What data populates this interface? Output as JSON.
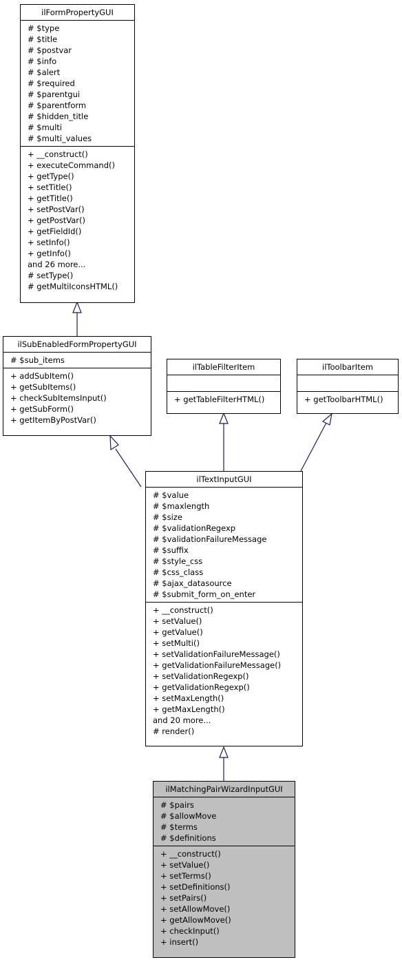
{
  "classes": {
    "form_property": {
      "name": "ilFormPropertyGUI",
      "attributes": [
        "# $type",
        "# $title",
        "# $postvar",
        "# $info",
        "# $alert",
        "# $required",
        "# $parentgui",
        "# $parentform",
        "# $hidden_title",
        "# $multi",
        "# $multi_values"
      ],
      "methods": [
        "+ __construct()",
        "+ executeCommand()",
        "+ getType()",
        "+ setTitle()",
        "+ getTitle()",
        "+ setPostVar()",
        "+ getPostVar()",
        "+ getFieldId()",
        "+ setInfo()",
        "+ getInfo()",
        "and 26 more...",
        "# setType()",
        "# getMultiIconsHTML()"
      ]
    },
    "sub_enabled": {
      "name": "ilSubEnabledFormPropertyGUI",
      "attributes": [
        "# $sub_items"
      ],
      "methods": [
        "+ addSubItem()",
        "+ getSubItems()",
        "+ checkSubItemsInput()",
        "+ getSubForm()",
        "+ getItemByPostVar()"
      ]
    },
    "table_filter": {
      "name": "ilTableFilterItem",
      "attributes": [],
      "methods": [
        "+ getTableFilterHTML()"
      ]
    },
    "toolbar_item": {
      "name": "ilToolbarItem",
      "attributes": [],
      "methods": [
        "+ getToolbarHTML()"
      ]
    },
    "text_input": {
      "name": "ilTextInputGUI",
      "attributes": [
        "# $value",
        "# $maxlength",
        "# $size",
        "# $validationRegexp",
        "# $validationFailureMessage",
        "# $suffix",
        "# $style_css",
        "# $css_class",
        "# $ajax_datasource",
        "# $submit_form_on_enter"
      ],
      "methods": [
        "+ __construct()",
        "+ setValue()",
        "+ getValue()",
        "+ setMulti()",
        "+ setValidationFailureMessage()",
        "+ getValidationFailureMessage()",
        "+ setValidationRegexp()",
        "+ getValidationRegexp()",
        "+ setMaxLength()",
        "+ getMaxLength()",
        "and 20 more...",
        "# render()"
      ]
    },
    "matching_pair": {
      "name": "ilMatchingPairWizardInputGUI",
      "attributes": [
        "# $pairs",
        "# $allowMove",
        "# $terms",
        "# $definitions"
      ],
      "methods": [
        "+ __construct()",
        "+ setValue()",
        "+ setTerms()",
        "+ setDefinitions()",
        "+ setPairs()",
        "+ setAllowMove()",
        "+ getAllowMove()",
        "+ checkInput()",
        "+ insert()"
      ]
    }
  },
  "edges": [
    {
      "from": "ilSubEnabledFormPropertyGUI",
      "to": "ilFormPropertyGUI",
      "type": "inheritance"
    },
    {
      "from": "ilTextInputGUI",
      "to": "ilSubEnabledFormPropertyGUI",
      "type": "inheritance"
    },
    {
      "from": "ilTextInputGUI",
      "to": "ilTableFilterItem",
      "type": "inheritance"
    },
    {
      "from": "ilTextInputGUI",
      "to": "ilToolbarItem",
      "type": "inheritance"
    },
    {
      "from": "ilMatchingPairWizardInputGUI",
      "to": "ilTextInputGUI",
      "type": "inheritance"
    }
  ],
  "colors": {
    "edge": "#191970",
    "highlight_fill": "#bfbfbf"
  }
}
